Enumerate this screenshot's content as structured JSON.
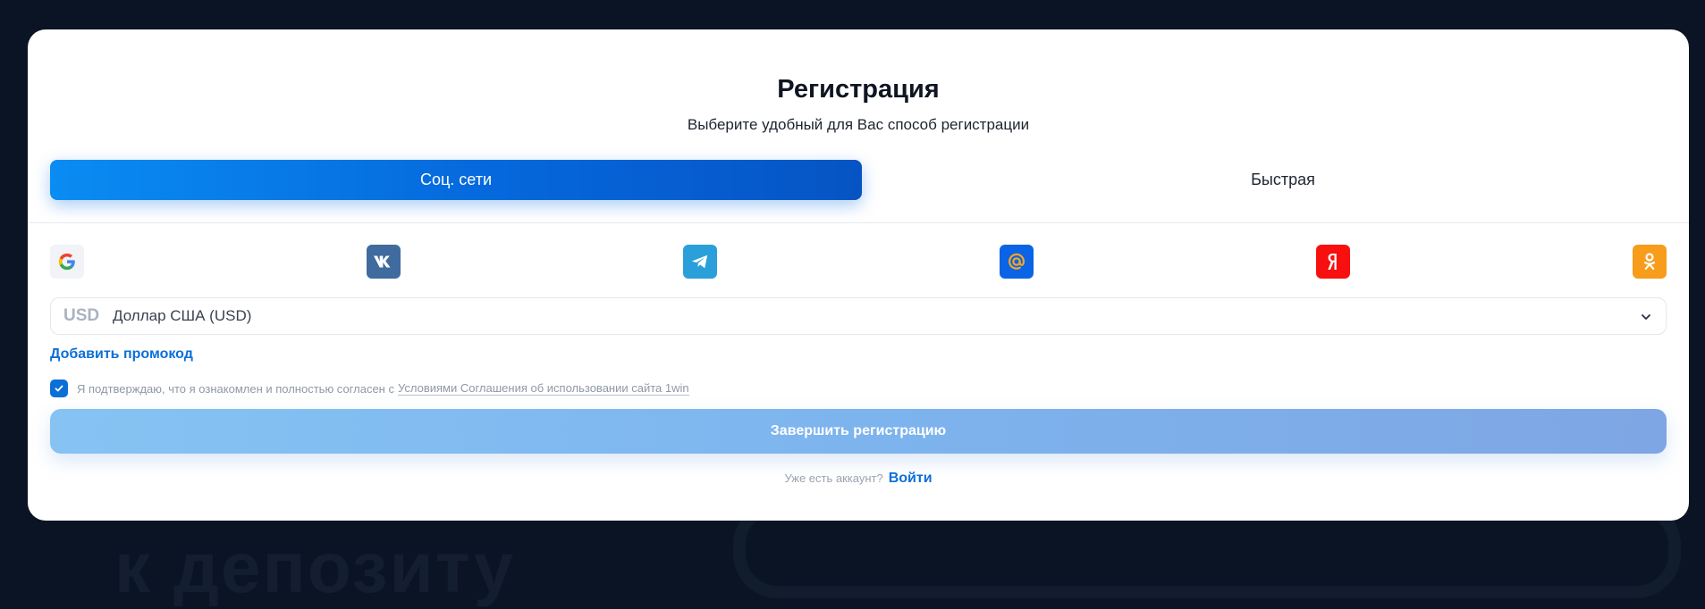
{
  "background": {
    "text": "к депозиту"
  },
  "modal": {
    "title": "Регистрация",
    "subtitle": "Выберите удобный для Вас способ регистрации"
  },
  "tabs": [
    {
      "label": "Соц. сети",
      "active": true
    },
    {
      "label": "Быстрая",
      "active": false
    }
  ],
  "social": [
    {
      "icon": "google-icon",
      "color": "#f1f3f6"
    },
    {
      "icon": "vk-icon",
      "color": "#3f6b9e"
    },
    {
      "icon": "telegram-icon",
      "color": "#2a9fd9"
    },
    {
      "icon": "mail-ru-icon",
      "color": "#0b63e6"
    },
    {
      "icon": "yandex-icon",
      "color": "#f80f0f"
    },
    {
      "icon": "odnoklassniki-icon",
      "color": "#f79c1b"
    }
  ],
  "currency": {
    "code": "USD",
    "name": "Доллар США (USD)"
  },
  "promo": {
    "label": "Добавить промокод"
  },
  "agreement": {
    "checked": true,
    "text": "Я подтверждаю, что я ознакомлен и полностью согласен с",
    "link": "Условиями Соглашения об использовании сайта 1win"
  },
  "submit": {
    "label": "Завершить регистрацию"
  },
  "login": {
    "question": "Уже есть аккаунт?",
    "link": "Войти"
  },
  "colors": {
    "accent": "#0b6fd8",
    "background": "#0b1424"
  }
}
